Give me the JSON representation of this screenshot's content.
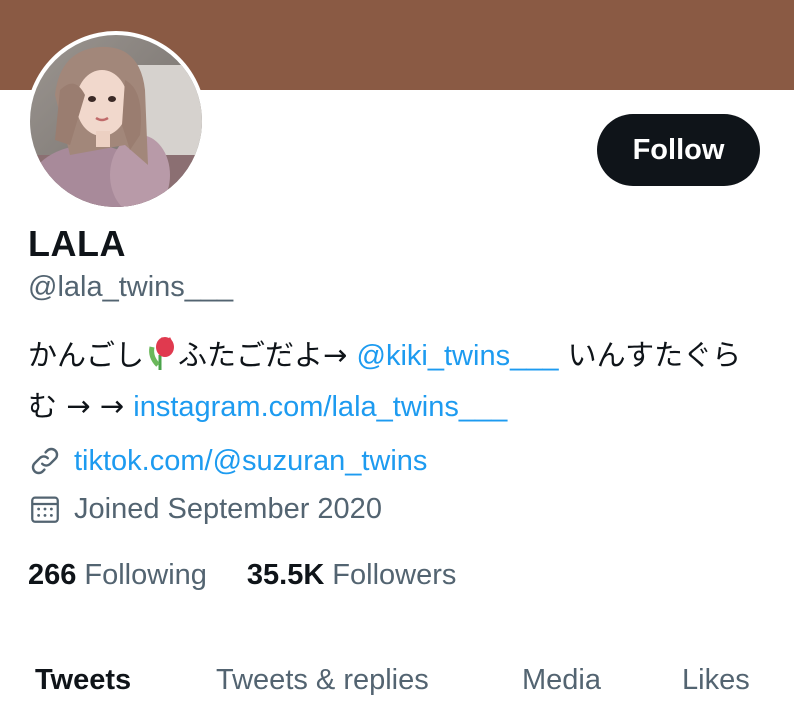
{
  "profile": {
    "display_name": "LALA",
    "handle": "@lala_twins___",
    "follow_label": "Follow",
    "bio": {
      "text1": "かんごし",
      "text2": "ふたごだよ→ ",
      "mention": "@kiki_twins___",
      "text3": " いんすたぐらむ → → ",
      "instagram_link": "instagram.com/lala_twins___"
    },
    "website": "tiktok.com/@suzuran_twins",
    "joined": "Joined September 2020"
  },
  "stats": {
    "following_count": "266",
    "following_label": "Following",
    "followers_count": "35.5K",
    "followers_label": "Followers"
  },
  "tabs": [
    {
      "label": "Tweets",
      "active": true
    },
    {
      "label": "Tweets & replies",
      "active": false
    },
    {
      "label": "Media",
      "active": false
    },
    {
      "label": "Likes",
      "active": false
    }
  ],
  "icons": {
    "link": "link-icon",
    "calendar": "calendar-icon",
    "bio_emoji": "tulip-icon"
  },
  "colors": {
    "banner": "#8a5a44",
    "accent_link": "#1d9bf0",
    "follow_button": "#0f1419",
    "secondary_text": "#536471"
  }
}
